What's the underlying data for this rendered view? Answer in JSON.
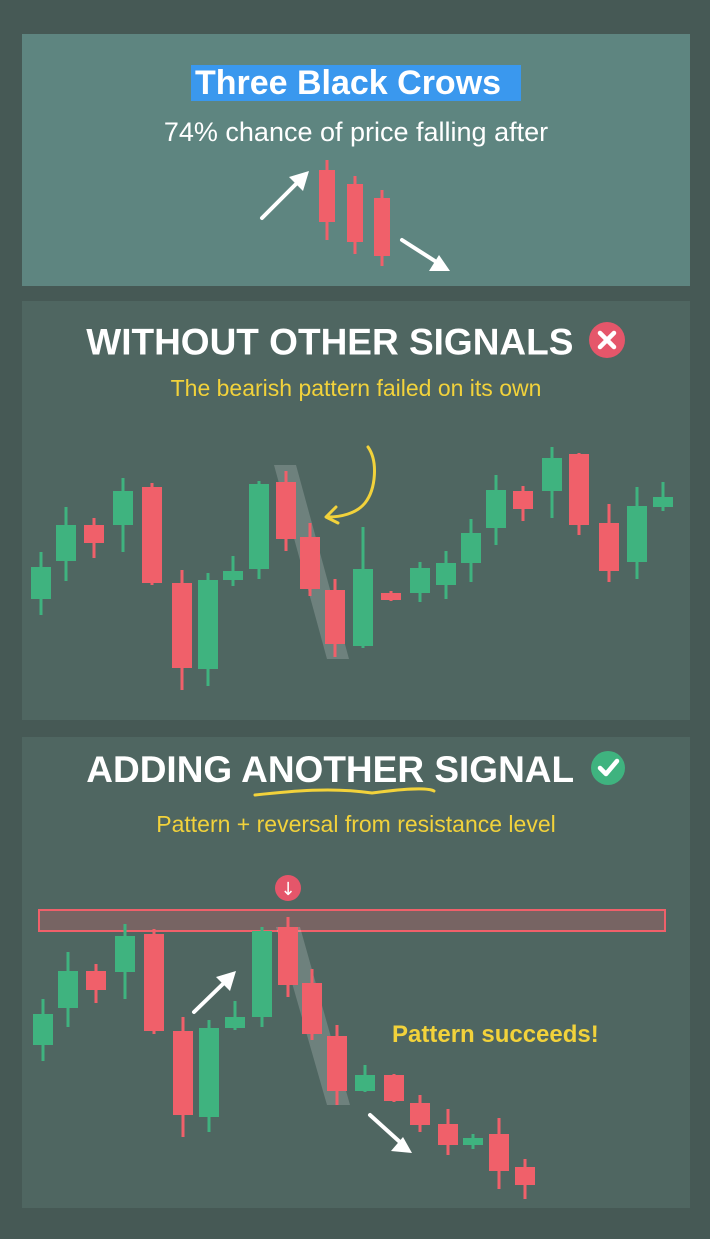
{
  "section1": {
    "title": "Three Black Crows",
    "subtitle": "74% chance of price falling after"
  },
  "section2": {
    "heading": "WITHOUT OTHER SIGNALS",
    "caption": "The bearish pattern failed on its own"
  },
  "section3": {
    "heading_pre": "ADDING ",
    "heading_em": "ANOTHER",
    "heading_post": " SIGNAL",
    "caption": "Pattern + reversal from resistance level",
    "success_text": "Pattern succeeds!",
    "marker_glyph": "↓"
  },
  "colors": {
    "bull": "#3fb37f",
    "bear": "#f0606a",
    "highlight": "#f2d23b",
    "title_bg": "#3a98ee"
  },
  "icons": [
    "arrow-up-right-icon",
    "arrow-down-right-icon",
    "cross-mark-icon",
    "check-mark-icon",
    "down-arrow-marker-icon"
  ]
}
